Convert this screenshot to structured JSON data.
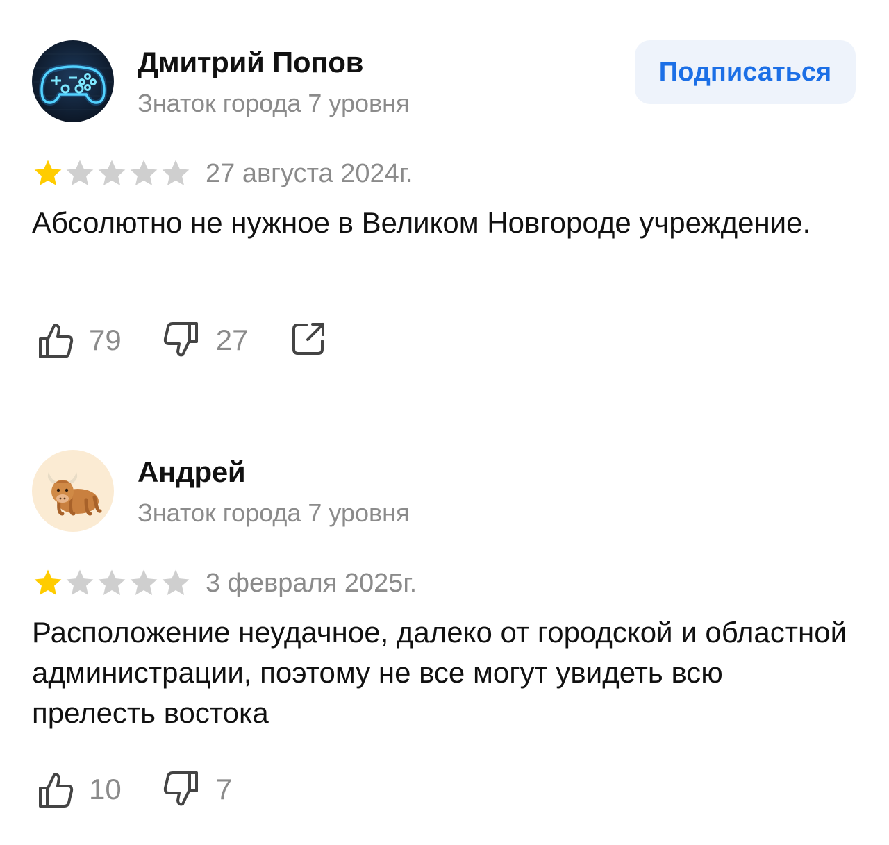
{
  "reviews": [
    {
      "author_name": "Дмитрий Попов",
      "author_level": "Знаток города 7 уровня",
      "avatar_icon": "gamepad-neon-avatar",
      "rating": 1,
      "rating_max": 5,
      "date": "27 августа 2024г.",
      "text": "Абсолютно не нужное в Великом Новгороде учреждение.",
      "likes": "79",
      "dislikes": "27",
      "subscribe_label": "Подписаться"
    },
    {
      "author_name": "Андрей",
      "author_level": "Знаток города 7 уровня",
      "avatar_icon": "yak-avatar",
      "rating": 1,
      "rating_max": 5,
      "date": "3 февраля 2025г.",
      "text": "Расположение неудачное, далеко от городской и областной администрации, поэтому не все могут увидеть всю прелесть востока",
      "likes": "10",
      "dislikes": "7"
    }
  ],
  "colors": {
    "star_filled": "#FFCC00",
    "star_empty": "#CFCFCF",
    "subscribe_text": "#1C6FE6",
    "subscribe_bg": "#EEF3FB",
    "muted_text": "#8B8B8B"
  }
}
